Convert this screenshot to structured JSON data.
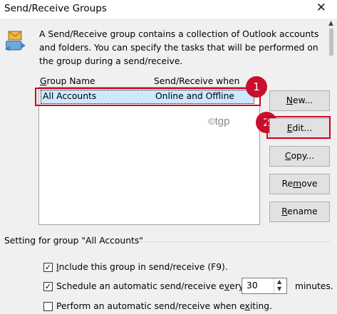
{
  "window": {
    "title": "Send/Receive Groups",
    "close_glyph": "✕"
  },
  "description": "A Send/Receive group contains a collection of Outlook accounts and folders. You can specify the tasks that will be performed on the group during a send/receive.",
  "list": {
    "columns": [
      "Group Name",
      "Send/Receive when"
    ],
    "rows": [
      {
        "name": "All Accounts",
        "when": "Online and Offline"
      }
    ]
  },
  "badges": [
    "1",
    "2"
  ],
  "buttons": {
    "new": "New...",
    "edit": "Edit...",
    "copy": "Copy...",
    "remove": "Remove",
    "rename": "Rename"
  },
  "watermark": {
    "symbol": "©",
    "text": "tgp"
  },
  "settings": {
    "group_label": "Setting for group \"All Accounts\"",
    "include": {
      "label": "Include this group in send/receive (F9).",
      "checked": true
    },
    "schedule": {
      "label": "Schedule an automatic send/receive every",
      "checked": true,
      "value": "30",
      "unit": "minutes."
    },
    "exit": {
      "label": "Perform an automatic send/receive when exiting.",
      "checked": false
    }
  },
  "icons": {
    "app": "send-receive-icon",
    "check": "✓"
  },
  "colors": {
    "highlight_red": "#d0021b",
    "selection": "#cde8ff",
    "badge": "#c8102e"
  }
}
